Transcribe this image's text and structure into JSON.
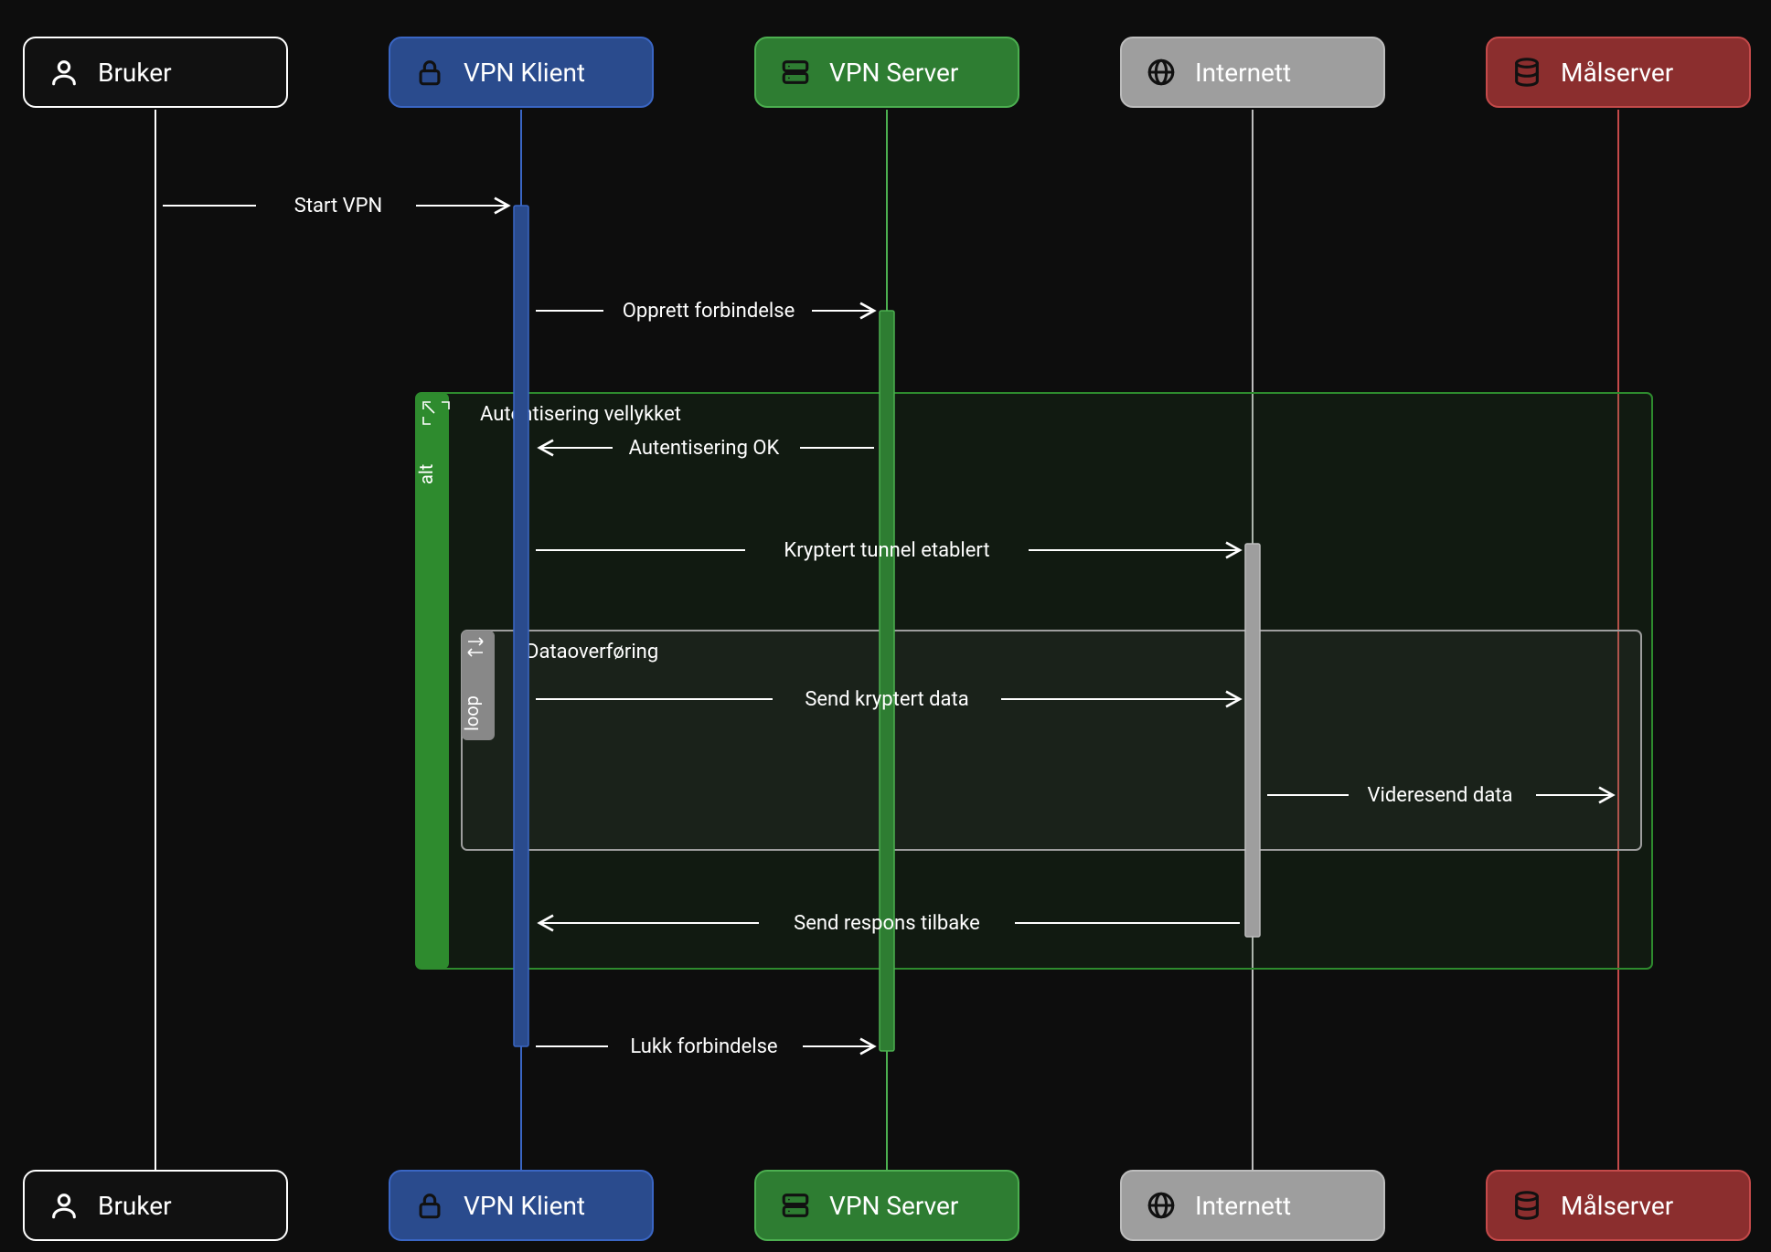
{
  "actors": {
    "user": {
      "label": "Bruker",
      "fill": "#111",
      "stroke": "#fff",
      "line": "#fff",
      "icon": "user"
    },
    "client": {
      "label": "VPN Klient",
      "fill": "#2a4b8d",
      "stroke": "#3a66c4",
      "line": "#3a66c4",
      "icon": "lock"
    },
    "server": {
      "label": "VPN Server",
      "fill": "#2e7d32",
      "stroke": "#4caf50",
      "line": "#4caf50",
      "icon": "server"
    },
    "internet": {
      "label": "Internett",
      "fill": "#9e9e9e",
      "stroke": "#bdbdbd",
      "line": "#bdbdbd",
      "icon": "globe"
    },
    "target": {
      "label": "Målserver",
      "fill": "#8b2e2e",
      "stroke": "#c44a4a",
      "line": "#c44a4a",
      "icon": "db"
    }
  },
  "messages": {
    "m1": "Start VPN",
    "m2": "Opprett forbindelse",
    "m3": "Autentisering OK",
    "m4": "Kryptert tunnel etablert",
    "m5": "Send kryptert data",
    "m6": "Videresend data",
    "m7": "Send respons tilbake",
    "m8": "Lukk forbindelse"
  },
  "frames": {
    "alt": {
      "tag": "alt",
      "condition": "Autentisering vellykket"
    },
    "loop": {
      "tag": "loop",
      "condition": "Dataoverføring"
    }
  }
}
